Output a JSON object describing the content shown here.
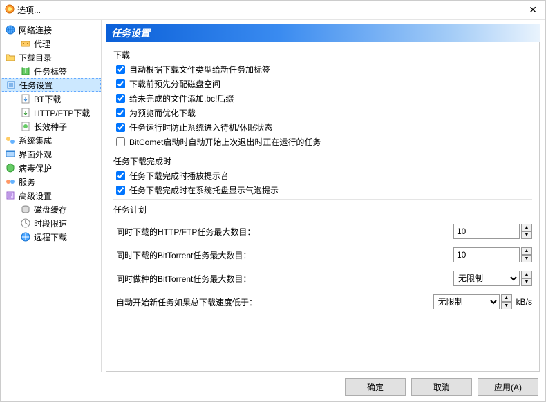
{
  "window": {
    "title": "选项..."
  },
  "sidebar": {
    "items": [
      {
        "label": "网络连接",
        "icon": "globe"
      },
      {
        "label": "代理",
        "icon": "proxy",
        "child": true
      },
      {
        "label": "下载目录",
        "icon": "folder"
      },
      {
        "label": "任务标签",
        "icon": "tag",
        "child": true
      },
      {
        "label": "任务设置",
        "icon": "settings",
        "selected": true
      },
      {
        "label": "BT下载",
        "icon": "bt",
        "child": true
      },
      {
        "label": "HTTP/FTP下载",
        "icon": "http",
        "child": true
      },
      {
        "label": "长效种子",
        "icon": "seed",
        "child": true
      },
      {
        "label": "系统集成",
        "icon": "integration"
      },
      {
        "label": "界面外观",
        "icon": "appearance"
      },
      {
        "label": "病毒保护",
        "icon": "virus"
      },
      {
        "label": "服务",
        "icon": "service"
      },
      {
        "label": "高级设置",
        "icon": "advanced"
      },
      {
        "label": "磁盘缓存",
        "icon": "disk",
        "child": true
      },
      {
        "label": "时段限速",
        "icon": "clock",
        "child": true
      },
      {
        "label": "远程下载",
        "icon": "remote",
        "child": true
      }
    ]
  },
  "panel": {
    "title": "任务设置",
    "download_section": "下载",
    "checkboxes": [
      {
        "label": "自动根据下载文件类型给新任务加标签",
        "checked": true
      },
      {
        "label": "下载前预先分配磁盘空间",
        "checked": true
      },
      {
        "label": "给未完成的文件添加.bc!后缀",
        "checked": true
      },
      {
        "label": "为预览而优化下载",
        "checked": true
      },
      {
        "label": "任务运行时防止系统进入待机/休眠状态",
        "checked": true
      },
      {
        "label": "BitComet启动时自动开始上次退出时正在运行的任务",
        "checked": false
      }
    ],
    "complete_section": "任务下载完成时",
    "complete_checkboxes": [
      {
        "label": "任务下载完成时播放提示音",
        "checked": true
      },
      {
        "label": "任务下载完成时在系统托盘显示气泡提示",
        "checked": true
      }
    ],
    "schedule_section": "任务计划",
    "schedule": [
      {
        "label": "同时下载的HTTP/FTP任务最大数目：",
        "value": "10",
        "type": "number"
      },
      {
        "label": "同时下载的BitTorrent任务最大数目：",
        "value": "10",
        "type": "number"
      },
      {
        "label": "同时做种的BitTorrent任务最大数目：",
        "value": "无限制",
        "type": "select"
      },
      {
        "label": "自动开始新任务如果总下载速度低于：",
        "value": "无限制",
        "type": "select",
        "unit": "kB/s"
      }
    ]
  },
  "footer": {
    "ok": "确定",
    "cancel": "取消",
    "apply": "应用(A)"
  }
}
